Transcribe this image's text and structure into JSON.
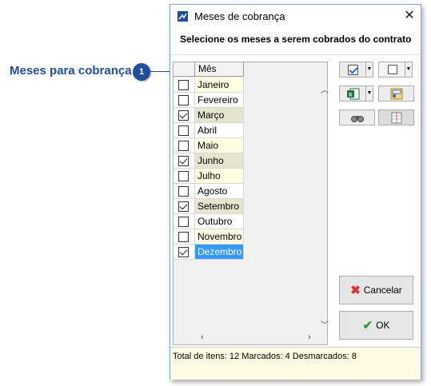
{
  "callout": {
    "label": "Meses para cobrança",
    "badge": "1"
  },
  "window": {
    "title": "Meses de cobrança",
    "instruction": "Selecione os meses a serem cobrados do contrato"
  },
  "grid": {
    "header": "Mês",
    "rows": [
      {
        "label": "Janeiro",
        "checked": false,
        "selected": false,
        "shade": "yellow"
      },
      {
        "label": "Fevereiro",
        "checked": false,
        "selected": false,
        "shade": "white"
      },
      {
        "label": "Março",
        "checked": true,
        "selected": false,
        "shade": "yellow"
      },
      {
        "label": "Abril",
        "checked": false,
        "selected": false,
        "shade": "white"
      },
      {
        "label": "Maio",
        "checked": false,
        "selected": false,
        "shade": "yellow"
      },
      {
        "label": "Junho",
        "checked": true,
        "selected": false,
        "shade": "white"
      },
      {
        "label": "Julho",
        "checked": false,
        "selected": false,
        "shade": "yellow"
      },
      {
        "label": "Agosto",
        "checked": false,
        "selected": false,
        "shade": "white"
      },
      {
        "label": "Setembro",
        "checked": true,
        "selected": false,
        "shade": "yellow"
      },
      {
        "label": "Outubro",
        "checked": false,
        "selected": false,
        "shade": "white"
      },
      {
        "label": "Novembro",
        "checked": false,
        "selected": false,
        "shade": "yellow"
      },
      {
        "label": "Dezembro",
        "checked": true,
        "selected": true,
        "shade": "white"
      }
    ]
  },
  "toolbar": {
    "icons": [
      "check-all-icon",
      "uncheck-all-icon",
      "excel-export-icon",
      "column-layout-icon",
      "binoculars-icon",
      "grid-settings-icon"
    ]
  },
  "buttons": {
    "cancel": "Cancelar",
    "ok": "OK"
  },
  "status": {
    "text": "Total de itens: 12 Marcados: 4 Desmarcados: 8"
  },
  "colors": {
    "accent": "#1f4e9c",
    "selected_row": "#3399ff",
    "status_bg": "#fdfce3"
  }
}
